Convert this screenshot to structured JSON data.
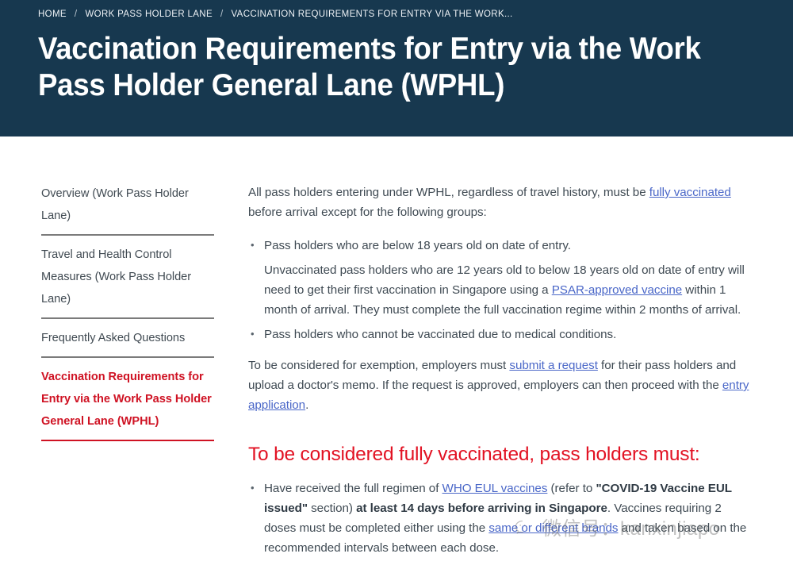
{
  "breadcrumb": {
    "items": [
      {
        "label": "HOME"
      },
      {
        "label": "WORK PASS HOLDER LANE"
      },
      {
        "label": "VACCINATION REQUIREMENTS FOR ENTRY VIA THE WORK..."
      }
    ],
    "separator": "/"
  },
  "header": {
    "title": "Vaccination Requirements for Entry via the Work Pass Holder General Lane (WPHL)",
    "background_color": "#17384f",
    "title_color": "#ffffff"
  },
  "sidebar": {
    "items": [
      {
        "label": "Overview (Work Pass Holder Lane)",
        "active": false
      },
      {
        "label": "Travel and Health Control Measures (Work Pass Holder Lane)",
        "active": false
      },
      {
        "label": "Frequently Asked Questions",
        "active": false
      },
      {
        "label": "Vaccination Requirements for Entry via the Work Pass Holder General Lane (WPHL)",
        "active": true
      }
    ],
    "active_color": "#cf1223"
  },
  "main": {
    "intro": {
      "part1": "All pass holders entering under WPHL, regardless of travel history, must be ",
      "link1": "fully vaccinated",
      "part2": " before arrival except for the following groups:"
    },
    "bullets": [
      {
        "text": "Pass holders who are below 18 years old on date of entry.",
        "sub_part1": "Unvaccinated pass holders who are 12 years old to below 18 years old on date of entry will need to get their first vaccination in Singapore using a ",
        "sub_link": "PSAR-approved vaccine",
        "sub_part2": " within 1 month of arrival. They must complete the full vaccination regime within 2 months of arrival."
      },
      {
        "text": "Pass holders who cannot be vaccinated due to medical conditions."
      }
    ],
    "exemption": {
      "part1": "To be considered for exemption, employers must ",
      "link1": "submit a request",
      "part2": " for their pass holders and upload a doctor's memo. If the request is approved, employers can then proceed with the ",
      "link2": "entry application",
      "part3": "."
    },
    "section_heading": "To be considered fully vaccinated, pass holders must:",
    "section_heading_color": "#e21223",
    "vaccinated_bullet": {
      "part1": "Have received the full regimen of ",
      "link1": "WHO EUL vaccines",
      "part2": " (refer to ",
      "bold1": "\"COVID-19 Vaccine EUL issued\"",
      "part3": " section) ",
      "bold2": "at least 14 days before arriving in Singapore",
      "part4": ". Vaccines requiring 2 doses must be completed either using the ",
      "link2": "same or different brands",
      "part5": " and taken based on the recommended intervals between each dose."
    },
    "link_color": "#4a67c8",
    "text_color": "#3f4a53"
  },
  "watermark": {
    "text": "微信号：kanxinjiapo",
    "icon": "wechat-icon"
  }
}
